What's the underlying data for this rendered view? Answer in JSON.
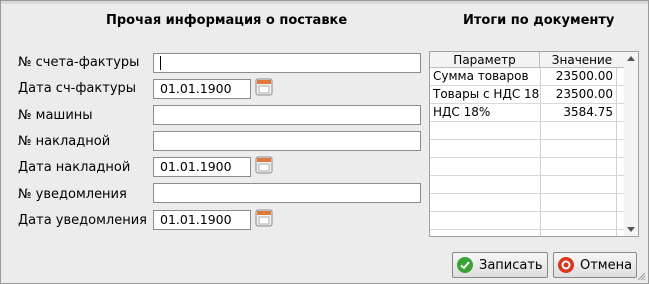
{
  "section_left_title": "Прочая информация о поставке",
  "section_right_title": "Итоги по документу",
  "form": {
    "invoice_no_label": "№ счета-фактуры",
    "invoice_no_value": "",
    "invoice_date_label": "Дата сч-фактуры",
    "invoice_date_value": "01.01.1900",
    "vehicle_no_label": "№ машины",
    "vehicle_no_value": "",
    "waybill_no_label": "№ накладной",
    "waybill_no_value": "",
    "waybill_date_label": "Дата накладной",
    "waybill_date_value": "01.01.1900",
    "notice_no_label": "№ уведомления",
    "notice_no_value": "",
    "notice_date_label": "Дата уведомления",
    "notice_date_value": "01.01.1900"
  },
  "totals": {
    "columns": [
      "Параметр",
      "Значение"
    ],
    "rows": [
      {
        "param": "Сумма товаров",
        "value": "23500.00"
      },
      {
        "param": "Товары с НДС 18",
        "value": "23500.00"
      },
      {
        "param": "НДС 18%",
        "value": "3584.75"
      }
    ]
  },
  "buttons": {
    "save_label": "Записать",
    "cancel_label": "Отмена"
  },
  "colors": {
    "save_icon": "#3aa335",
    "cancel_icon": "#d9341c"
  }
}
